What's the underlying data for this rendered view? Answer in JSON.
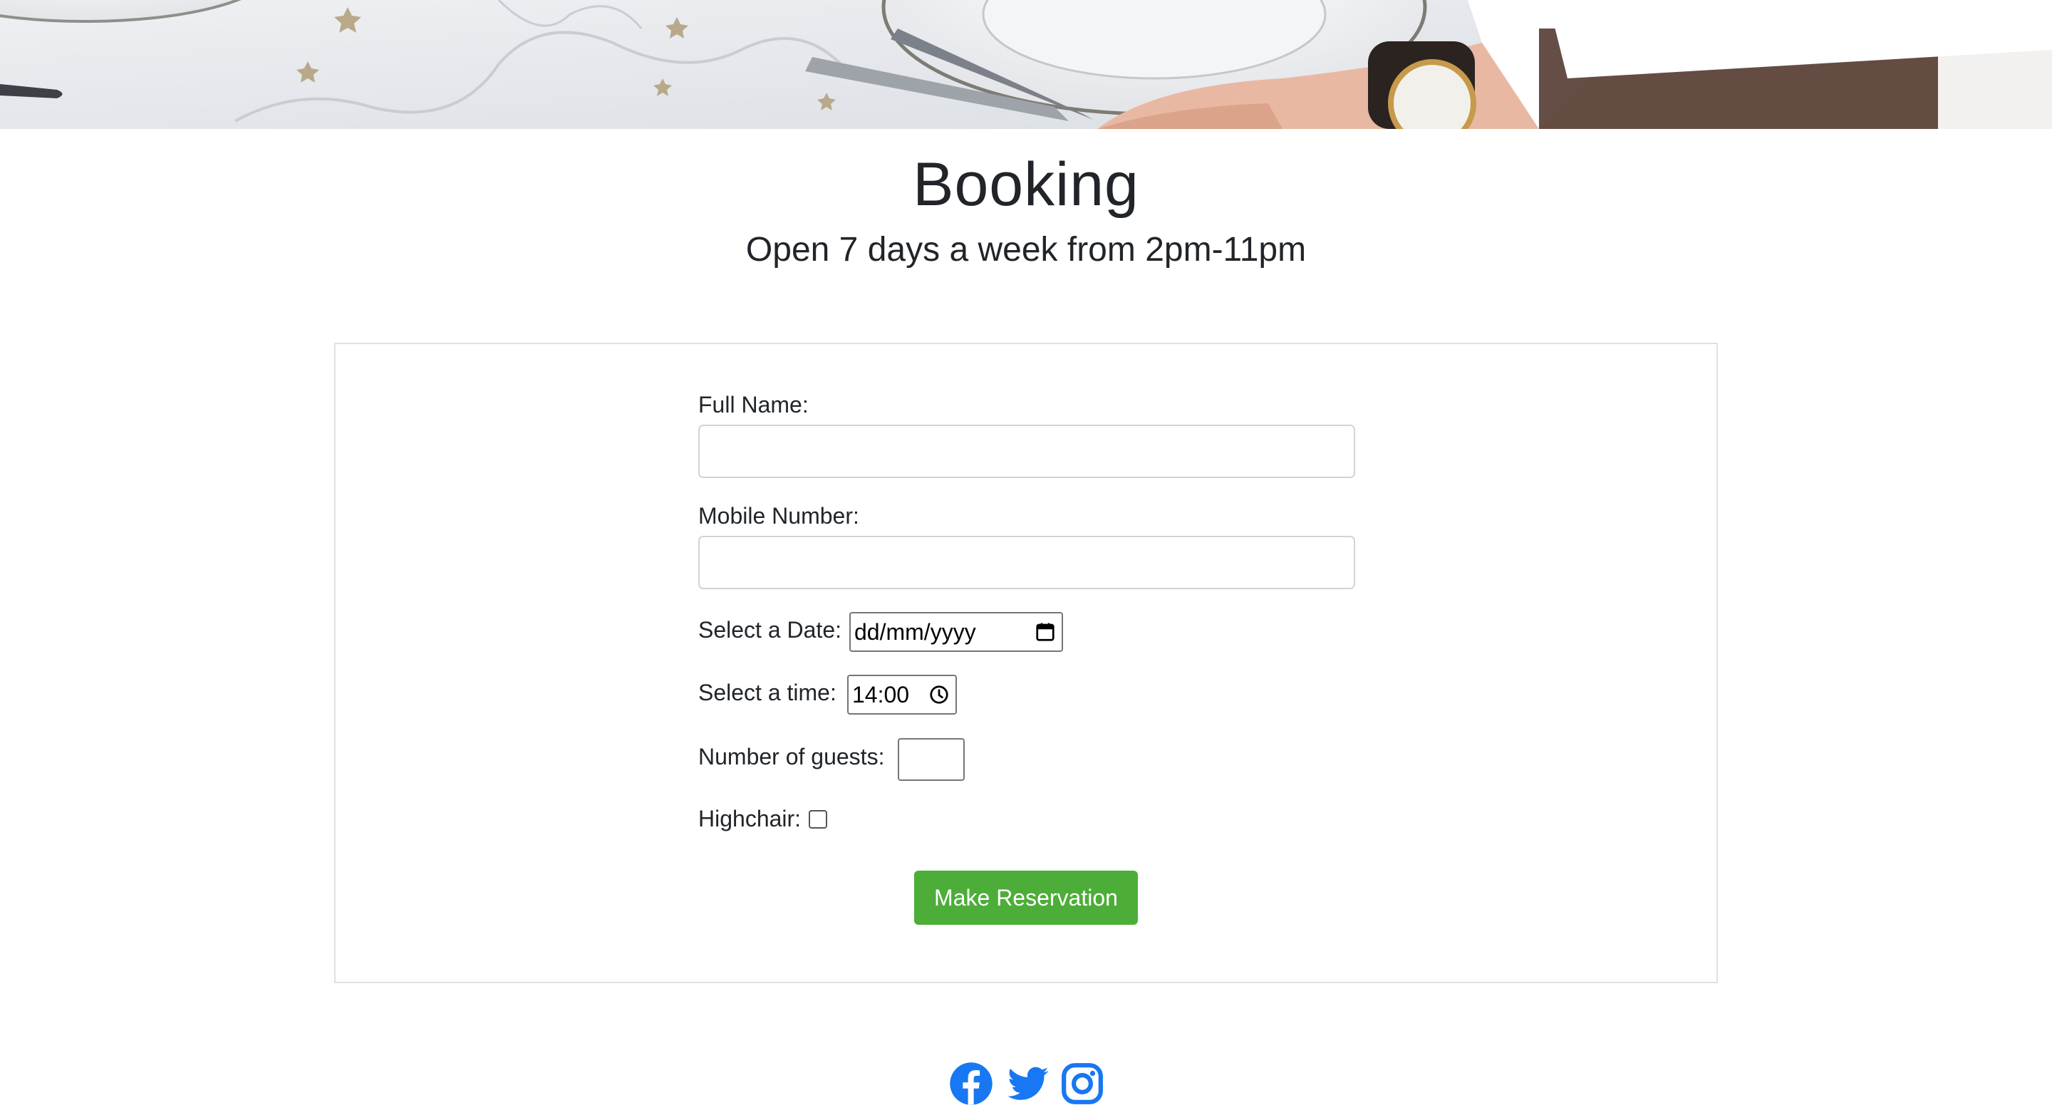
{
  "hero": {
    "image": "table-setting-photo"
  },
  "header": {
    "title": "Booking",
    "subtitle": "Open 7 days a week from 2pm-11pm"
  },
  "form": {
    "full_name": {
      "label": "Full Name:",
      "value": ""
    },
    "mobile_number": {
      "label": "Mobile Number:",
      "value": ""
    },
    "date": {
      "label": "Select a Date:",
      "value": "dd/mm/yyyy",
      "icon": "calendar-icon"
    },
    "time": {
      "label": "Select a time:",
      "value": "14:00",
      "icon": "clock-icon"
    },
    "guests": {
      "label": "Number of guests:",
      "value": ""
    },
    "highchair": {
      "label": "Highchair:",
      "checked": false
    },
    "submit_label": "Make Reservation"
  },
  "footer": {
    "social": [
      {
        "name": "facebook-icon"
      },
      {
        "name": "twitter-icon"
      },
      {
        "name": "instagram-icon"
      }
    ]
  },
  "colors": {
    "accent": "#4cae38",
    "social": "#1877f2",
    "text": "#212529",
    "border": "#dee2e6"
  }
}
